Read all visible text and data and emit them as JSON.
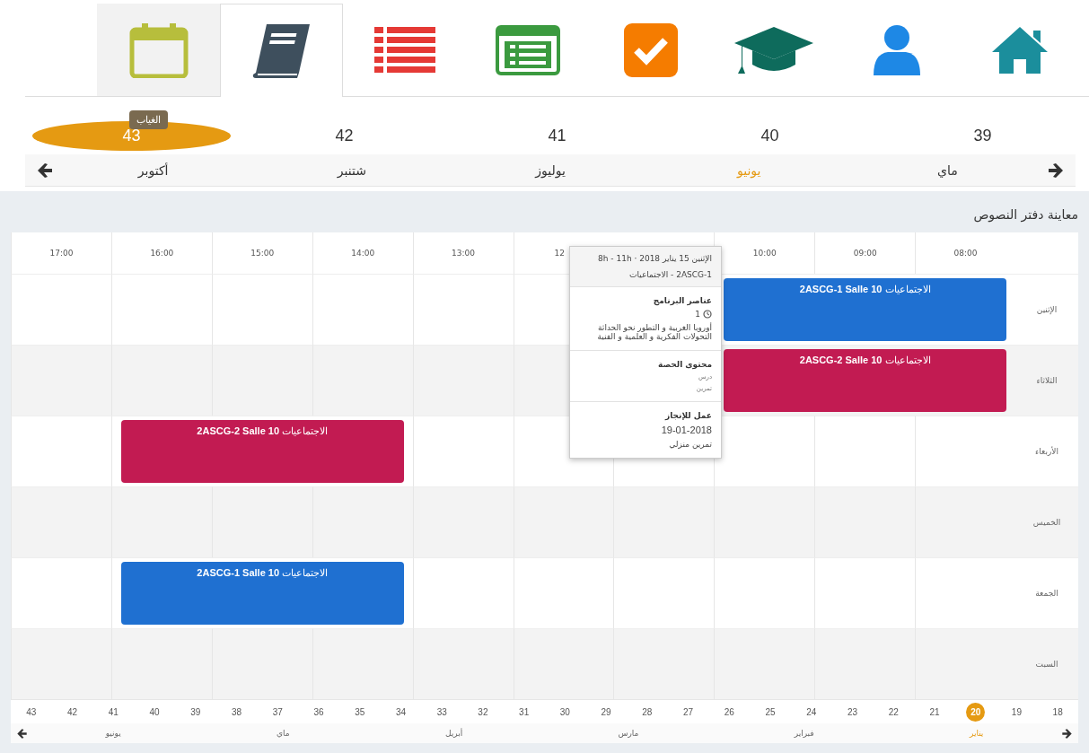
{
  "nav_tabs": [
    {
      "kind": "home",
      "selected": false
    },
    {
      "kind": "user",
      "selected": false
    },
    {
      "kind": "cap",
      "selected": false
    },
    {
      "kind": "check",
      "selected": false
    },
    {
      "kind": "form",
      "selected": false
    },
    {
      "kind": "list",
      "selected": false
    },
    {
      "kind": "book",
      "selected": true
    },
    {
      "kind": "calendar",
      "selected": false,
      "tooltip": "الغياب"
    }
  ],
  "week_selector": {
    "weeks": [
      {
        "label": "39",
        "selected": false
      },
      {
        "label": "40",
        "selected": false
      },
      {
        "label": "41",
        "selected": false
      },
      {
        "label": "42",
        "selected": false
      },
      {
        "label": "43",
        "selected": true
      }
    ],
    "months": [
      {
        "label": "ماي",
        "selected": false
      },
      {
        "label": "يونيو",
        "selected": true
      },
      {
        "label": "يوليوز",
        "selected": false
      },
      {
        "label": "شتنبر",
        "selected": false
      },
      {
        "label": "أكتوبر",
        "selected": false
      }
    ]
  },
  "panel": {
    "title": "معاينة دفتر النصوص"
  },
  "timetable": {
    "hours": [
      {
        "kind": "full",
        "label": "08:00"
      },
      {
        "kind": "full",
        "label": "09:00"
      },
      {
        "kind": "full",
        "label": "10:00"
      },
      {
        "kind": "covered"
      },
      {
        "kind": "partial",
        "label": "12"
      },
      {
        "kind": "full",
        "label": "13:00"
      },
      {
        "kind": "full",
        "label": "14:00"
      },
      {
        "kind": "full",
        "label": "15:00"
      },
      {
        "kind": "full",
        "label": "16:00"
      },
      {
        "kind": "full",
        "label": "17:00"
      }
    ],
    "days": [
      {
        "label": "الإثنين",
        "slots": [
          {
            "kind": "event",
            "text": "الاجتماعيات **2ASCG-1 Salle 10**",
            "color": "#1f70d1"
          },
          {
            "kind": "continued"
          },
          {
            "kind": "continued"
          },
          {
            "kind": "covered"
          },
          {
            "kind": "empty"
          },
          {
            "kind": "empty"
          },
          {
            "kind": "empty"
          },
          {
            "kind": "empty"
          },
          {
            "kind": "empty"
          },
          {
            "kind": "empty"
          }
        ]
      },
      {
        "label": "الثلاثاء",
        "slots": [
          {
            "kind": "event",
            "text": "الاجتماعيات **2ASCG-2 Salle 10**",
            "color": "#c21b52"
          },
          {
            "kind": "continued"
          },
          {
            "kind": "continued"
          },
          {
            "kind": "covered"
          },
          {
            "kind": "empty"
          },
          {
            "kind": "empty"
          },
          {
            "kind": "empty"
          },
          {
            "kind": "empty"
          },
          {
            "kind": "empty"
          },
          {
            "kind": "empty"
          }
        ]
      },
      {
        "label": "الأربعاء",
        "slots": [
          {
            "kind": "empty"
          },
          {
            "kind": "empty"
          },
          {
            "kind": "empty"
          },
          {
            "kind": "empty"
          },
          {
            "kind": "empty"
          },
          {
            "kind": "empty"
          },
          {
            "kind": "event",
            "text": "الاجتماعيات **2ASCG-2 Salle 10**",
            "color": "#c21b52"
          },
          {
            "kind": "continued"
          },
          {
            "kind": "continued"
          },
          {
            "kind": "empty"
          }
        ]
      },
      {
        "label": "الخميس",
        "slots": [
          {
            "kind": "empty"
          },
          {
            "kind": "empty"
          },
          {
            "kind": "empty"
          },
          {
            "kind": "empty"
          },
          {
            "kind": "empty"
          },
          {
            "kind": "empty"
          },
          {
            "kind": "empty"
          },
          {
            "kind": "empty"
          },
          {
            "kind": "empty"
          },
          {
            "kind": "empty"
          }
        ]
      },
      {
        "label": "الجمعة",
        "slots": [
          {
            "kind": "empty"
          },
          {
            "kind": "empty"
          },
          {
            "kind": "empty"
          },
          {
            "kind": "empty"
          },
          {
            "kind": "empty"
          },
          {
            "kind": "empty"
          },
          {
            "kind": "event",
            "text": "الاجتماعيات **2ASCG-1 Salle 10**",
            "color": "#1f70d1"
          },
          {
            "kind": "continued"
          },
          {
            "kind": "continued"
          },
          {
            "kind": "empty"
          }
        ]
      },
      {
        "label": "السبت",
        "slots": [
          {
            "kind": "empty"
          },
          {
            "kind": "empty"
          },
          {
            "kind": "empty"
          },
          {
            "kind": "empty"
          },
          {
            "kind": "empty"
          },
          {
            "kind": "empty"
          },
          {
            "kind": "empty"
          },
          {
            "kind": "empty"
          },
          {
            "kind": "empty"
          },
          {
            "kind": "empty"
          }
        ]
      }
    ],
    "popup": {
      "date_line": "الإثنين 15 يناير 2018 · 8h - 11h",
      "class_line": "2ASCG-1 - الاجتماعيات",
      "sections": [
        {
          "title": "عناصر البرنامج",
          "items": [
            {
              "kind": "numbered",
              "text": "1"
            },
            {
              "kind": "text",
              "text": "أوروبا الغربية و التطور نحو الحداثة التحولات الفكرية و العلمية و الفنية"
            }
          ]
        },
        {
          "title": "محتوى الحصة",
          "items": [
            {
              "kind": "small",
              "text": "درس"
            },
            {
              "kind": "small",
              "text": "تمرين"
            }
          ]
        },
        {
          "title": "عمل للإنجاز",
          "items": [
            {
              "kind": "date",
              "text": "19-01-2018"
            },
            {
              "kind": "text",
              "text": "تمرين منزلي"
            }
          ]
        }
      ]
    }
  },
  "bottom_strip": {
    "weeks": [
      {
        "label": "18",
        "selected": false
      },
      {
        "label": "19",
        "selected": false
      },
      {
        "label": "20",
        "selected": true
      },
      {
        "label": "21",
        "selected": false
      },
      {
        "label": "22",
        "selected": false
      },
      {
        "label": "23",
        "selected": false
      },
      {
        "label": "24",
        "selected": false
      },
      {
        "label": "25",
        "selected": false
      },
      {
        "label": "26",
        "selected": false
      },
      {
        "label": "27",
        "selected": false
      },
      {
        "label": "28",
        "selected": false
      },
      {
        "label": "29",
        "selected": false
      },
      {
        "label": "30",
        "selected": false
      },
      {
        "label": "31",
        "selected": false
      },
      {
        "label": "32",
        "selected": false
      },
      {
        "label": "33",
        "selected": false
      },
      {
        "label": "34",
        "selected": false
      },
      {
        "label": "35",
        "selected": false
      },
      {
        "label": "36",
        "selected": false
      },
      {
        "label": "37",
        "selected": false
      },
      {
        "label": "38",
        "selected": false
      },
      {
        "label": "39",
        "selected": false
      },
      {
        "label": "40",
        "selected": false
      },
      {
        "label": "41",
        "selected": false
      },
      {
        "label": "42",
        "selected": false
      },
      {
        "label": "43",
        "selected": false
      }
    ],
    "months": [
      {
        "label": "يناير",
        "selected": true
      },
      {
        "label": "فبراير",
        "selected": false
      },
      {
        "label": "مارس",
        "selected": false
      },
      {
        "label": "أبريل",
        "selected": false
      },
      {
        "label": "ماي",
        "selected": false
      },
      {
        "label": "يونيو",
        "selected": false
      }
    ]
  }
}
